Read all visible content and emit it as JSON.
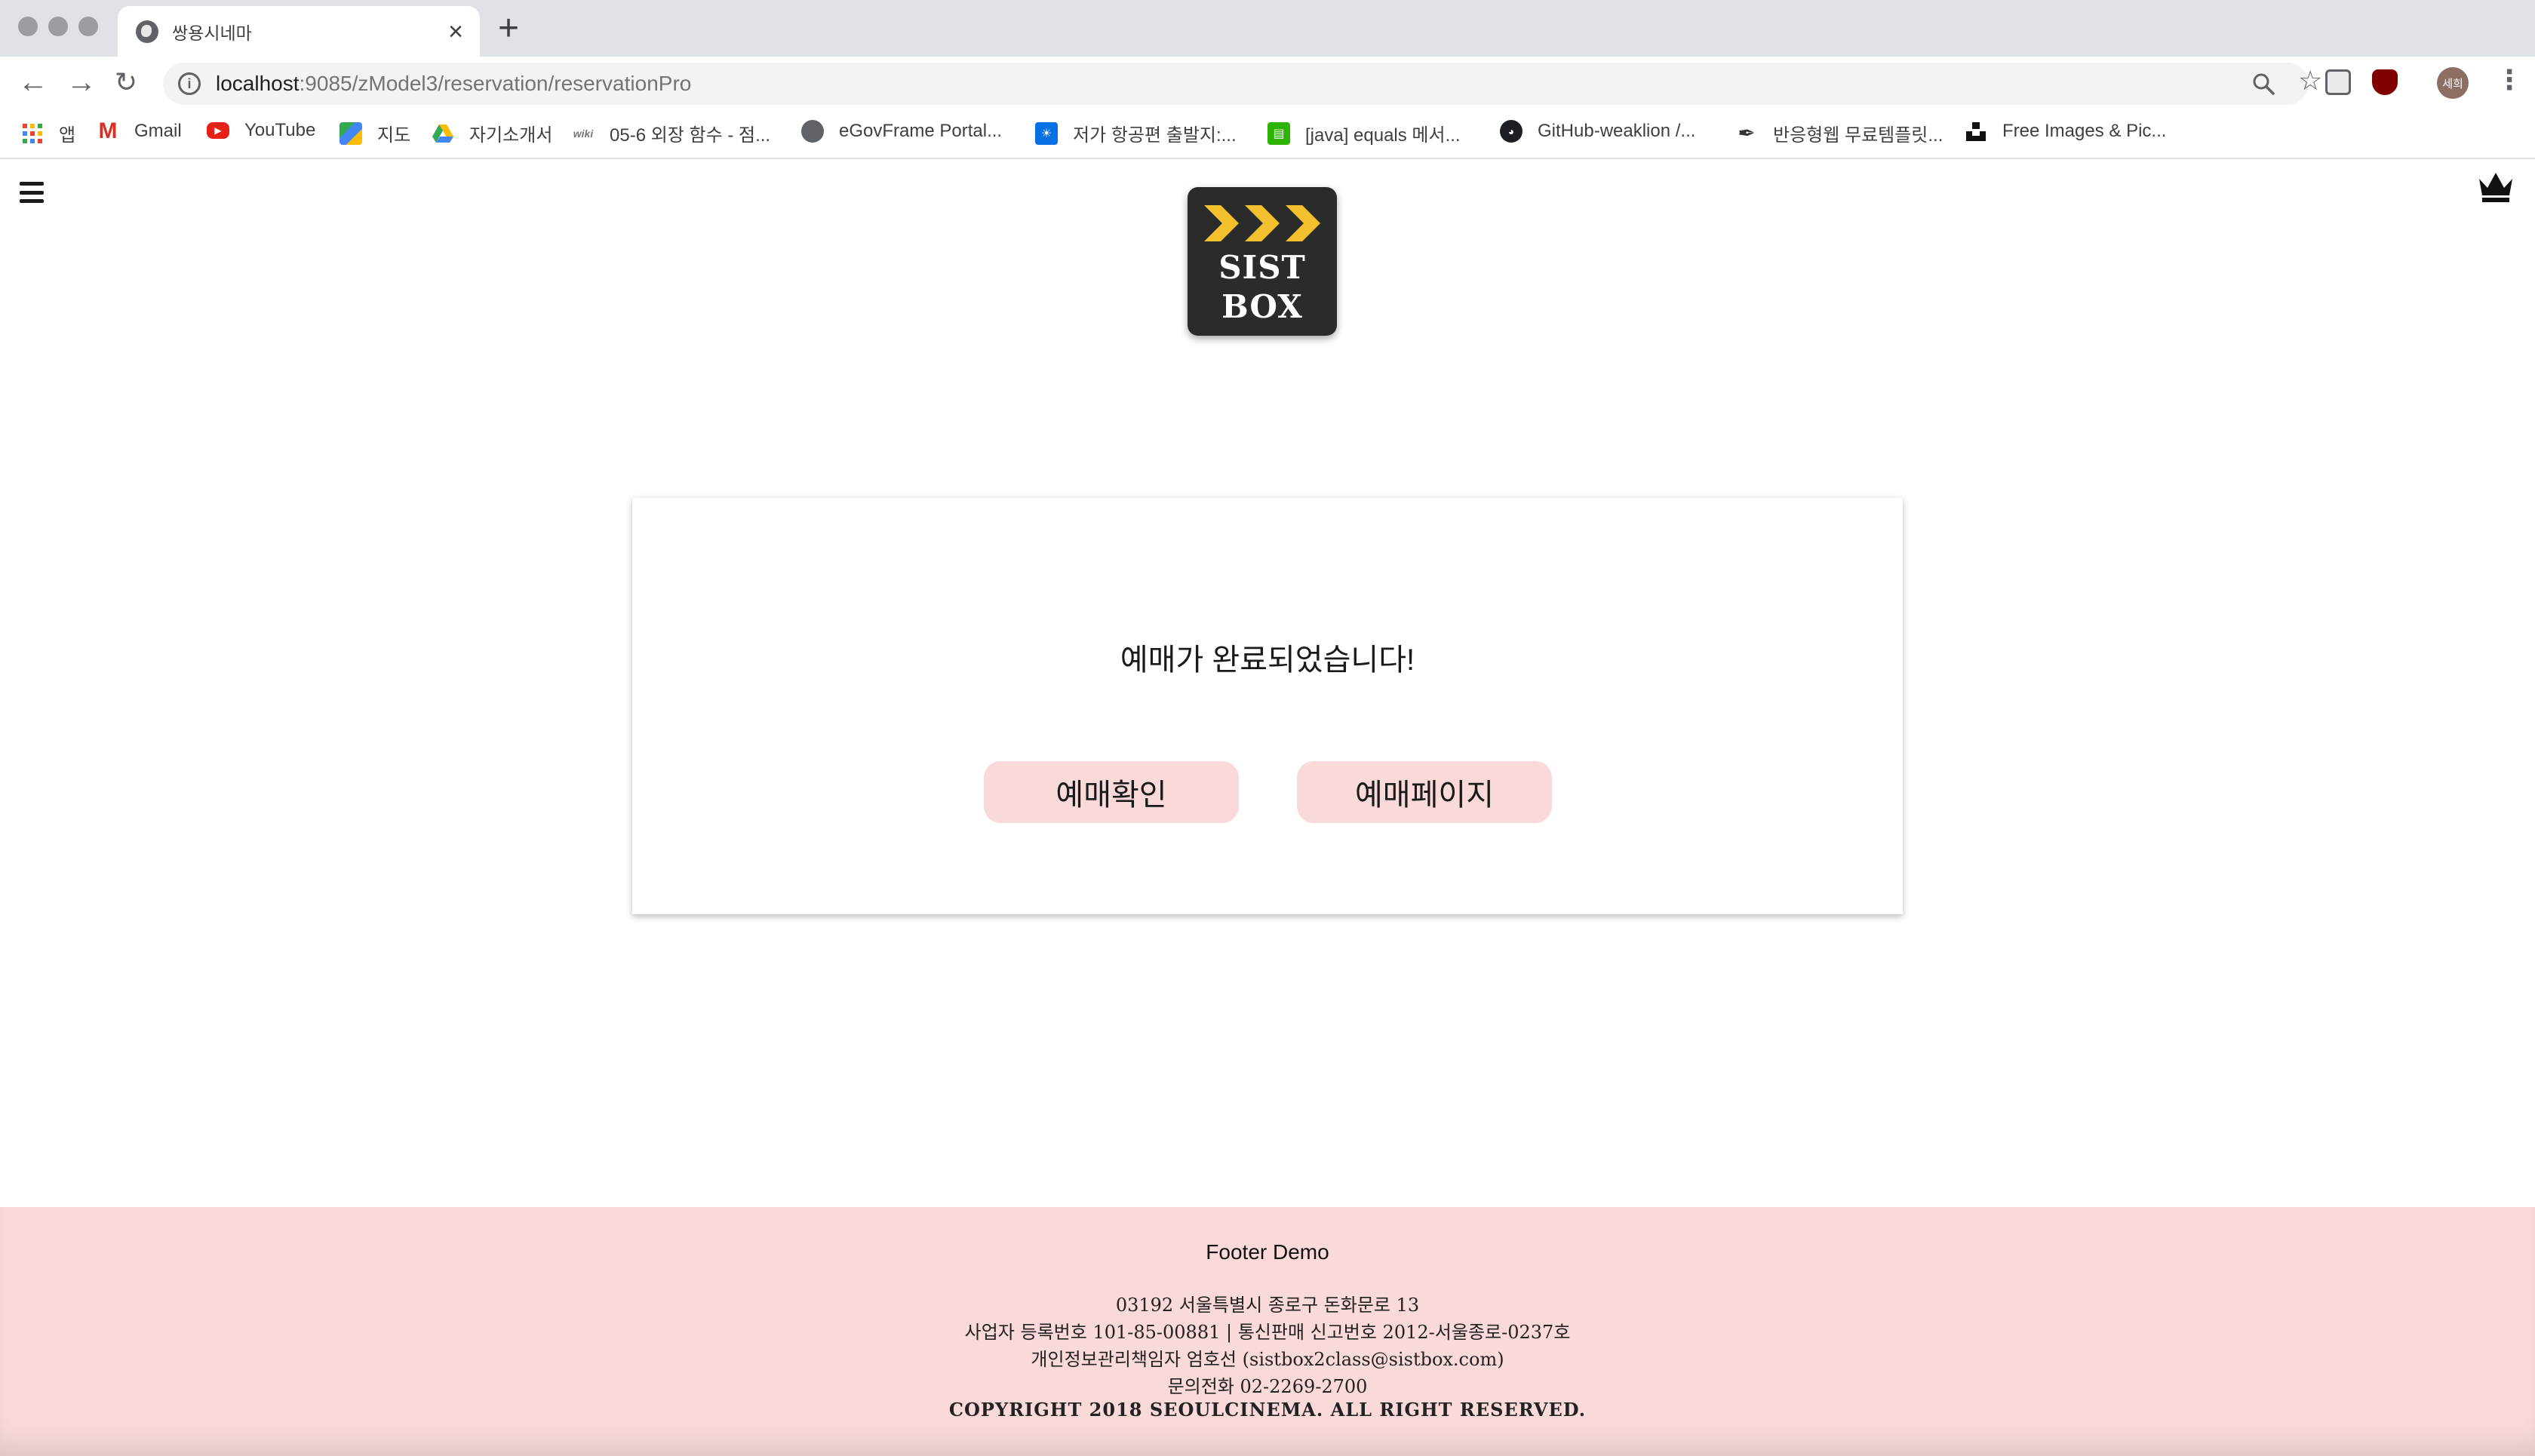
{
  "browser": {
    "tab_title": "쌍용시네마",
    "url_host": "localhost",
    "url_path": ":9085/zModel3/reservation/reservationPro",
    "profile_label": "세희",
    "bookmarks": [
      {
        "label": "앱",
        "icon": "apps-grid-icon"
      },
      {
        "label": "Gmail",
        "icon": "gmail-icon"
      },
      {
        "label": "YouTube",
        "icon": "youtube-icon"
      },
      {
        "label": "지도",
        "icon": "maps-icon"
      },
      {
        "label": "자기소개서",
        "icon": "google-drive-icon"
      },
      {
        "label": "05-6 외장 함수 - 점...",
        "icon": "wikidocs-icon"
      },
      {
        "label": "eGovFrame Portal...",
        "icon": "globe-icon"
      },
      {
        "label": "저가 항공편 출발지:...",
        "icon": "skyscanner-icon"
      },
      {
        "label": "[java] equals 메서...",
        "icon": "blog-icon"
      },
      {
        "label": "GitHub-weaklion /...",
        "icon": "github-icon"
      },
      {
        "label": "반응형웹 무료템플릿...",
        "icon": "pen-nib-icon"
      },
      {
        "label": "Free Images & Pic...",
        "icon": "unsplash-icon"
      }
    ]
  },
  "header": {
    "logo_line1": "SIST",
    "logo_line2": "BOX"
  },
  "main": {
    "message": "예매가 완료되었습니다!",
    "confirm_button": "예매확인",
    "reserve_page_button": "예매페이지"
  },
  "footer": {
    "title": "Footer Demo",
    "address": "03192 서울특별시 종로구 돈화문로 13",
    "registration": "사업자 등록번호 101-85-00881 | 통신판매 신고번호 2012-서울종로-0237호",
    "privacy_officer": "개인정보관리책임자 엄호선 (sistbox2class@sistbox.com)",
    "phone": "문의전화 02-2269-2700",
    "copyright": "COPYRIGHT 2018 SEOULCINEMA. ALL RIGHT RESERVED."
  },
  "colors": {
    "accent_pink": "#f9d9da",
    "logo_bg": "#2b2b2b",
    "logo_arrow": "#f3c02e"
  }
}
